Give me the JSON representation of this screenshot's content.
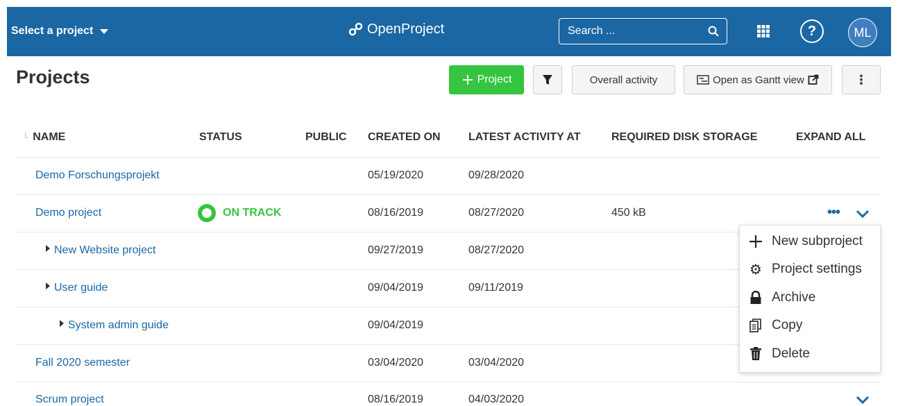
{
  "header": {
    "project_select": "Select a project",
    "logo_text": "OpenProject",
    "search_placeholder": "Search ...",
    "help_symbol": "?",
    "avatar_initials": "ML",
    "bg_color": "#1a67a3"
  },
  "toolbar": {
    "title": "Projects",
    "new_project_label": "Project",
    "overall_activity_label": "Overall activity",
    "gantt_label": "Open as Gantt view",
    "more_symbol": "⋮"
  },
  "table": {
    "columns": {
      "name": "NAME",
      "status": "STATUS",
      "public": "PUBLIC",
      "created_on": "CREATED ON",
      "latest_activity": "LATEST ACTIVITY AT",
      "disk_storage": "REQUIRED DISK STORAGE",
      "expand_all": "EXPAND ALL"
    },
    "rows": [
      {
        "name": "Demo Forschungsprojekt",
        "status": "",
        "created_on": "05/19/2020",
        "latest_activity": "09/28/2020",
        "disk_storage": ""
      },
      {
        "name": "Demo project",
        "status": "ON TRACK",
        "created_on": "08/16/2019",
        "latest_activity": "08/27/2020",
        "disk_storage": "450 kB"
      },
      {
        "name": "New Website project",
        "status": "",
        "created_on": "09/27/2019",
        "latest_activity": "08/27/2020",
        "disk_storage": ""
      },
      {
        "name": "User guide",
        "status": "",
        "created_on": "09/04/2019",
        "latest_activity": "09/11/2019",
        "disk_storage": ""
      },
      {
        "name": "System admin guide",
        "status": "",
        "created_on": "09/04/2019",
        "latest_activity": "",
        "disk_storage": ""
      },
      {
        "name": "Fall 2020 semester",
        "status": "",
        "created_on": "03/04/2020",
        "latest_activity": "03/04/2020",
        "disk_storage": ""
      },
      {
        "name": "Scrum project",
        "status": "",
        "created_on": "08/16/2019",
        "latest_activity": "04/03/2020",
        "disk_storage": ""
      }
    ]
  },
  "context_menu": {
    "items": [
      {
        "label": "New subproject",
        "icon": "plus-icon"
      },
      {
        "label": "Project settings",
        "icon": "gear-icon"
      },
      {
        "label": "Archive",
        "icon": "lock-icon"
      },
      {
        "label": "Copy",
        "icon": "copy-icon"
      },
      {
        "label": "Delete",
        "icon": "trash-icon"
      }
    ]
  },
  "colors": {
    "accent": "#1a67a3",
    "success": "#35c53f",
    "link": "#1a67a3"
  }
}
